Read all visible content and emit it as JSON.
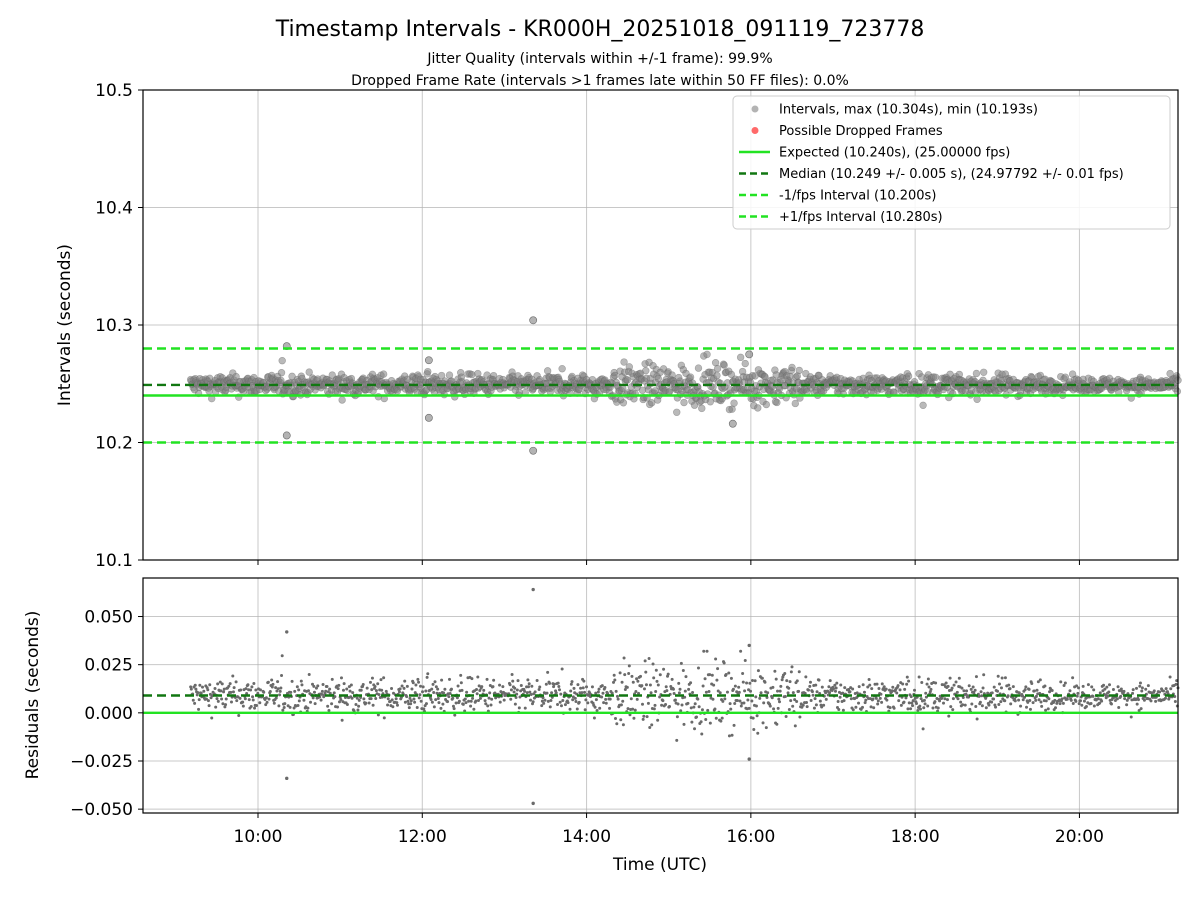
{
  "chart_data": [
    {
      "type": "scatter",
      "title": "Timestamp Intervals - KR000H_20251018_091119_723778",
      "subtitle_lines": [
        "Jitter Quality (intervals within +/-1 frame): 99.9%",
        "Dropped Frame Rate (intervals >1 frames late within 50 FF files): 0.0%"
      ],
      "ylabel": "Intervals (seconds)",
      "xlabel": "",
      "xlim_hours": [
        8.6,
        21.2
      ],
      "ylim": [
        10.1,
        10.5
      ],
      "yticks": [
        10.1,
        10.2,
        10.3,
        10.4,
        10.5
      ],
      "ytick_labels": [
        "10.1",
        "10.2",
        "10.3",
        "10.4",
        "10.5"
      ],
      "grid": true,
      "legend_position": "top-right",
      "legend": [
        {
          "label": "Intervals, max (10.304s), min (10.193s)",
          "marker": "circle",
          "color": "#808080"
        },
        {
          "label": "Possible Dropped Frames",
          "marker": "circle",
          "color": "#ff4444"
        },
        {
          "label": "Expected (10.240s), (25.00000 fps)",
          "marker": "solid",
          "color": "#22e322"
        },
        {
          "label": "Median (10.249 +/- 0.005 s), (24.97792 +/- 0.01 fps)",
          "marker": "dashed",
          "color": "#117711"
        },
        {
          "label": "-1/fps Interval (10.200s)",
          "marker": "dashed",
          "color": "#22e322"
        },
        {
          "label": "+1/fps Interval (10.280s)",
          "marker": "dashed",
          "color": "#22e322"
        }
      ],
      "reference_lines": [
        {
          "name": "expected",
          "y": 10.24,
          "style": "solid",
          "color": "#22e322"
        },
        {
          "name": "median",
          "y": 10.249,
          "style": "dashed",
          "color": "#117711"
        },
        {
          "name": "minus-one-fps",
          "y": 10.2,
          "style": "dashed",
          "color": "#22e322"
        },
        {
          "name": "plus-one-fps",
          "y": 10.28,
          "style": "dashed",
          "color": "#22e322"
        }
      ],
      "series_stats": {
        "max": 10.304,
        "min": 10.193,
        "start_hours": 9.18,
        "end_hours": 21.2,
        "count": 4200
      },
      "outliers": [
        {
          "x": 13.35,
          "y": 10.304
        },
        {
          "x": 13.35,
          "y": 10.193
        },
        {
          "x": 10.35,
          "y": 10.282
        },
        {
          "x": 10.35,
          "y": 10.206
        },
        {
          "x": 15.98,
          "y": 10.275
        },
        {
          "x": 15.78,
          "y": 10.216
        },
        {
          "x": 12.08,
          "y": 10.221
        },
        {
          "x": 12.08,
          "y": 10.27
        }
      ]
    },
    {
      "type": "scatter",
      "ylabel": "Residuals (seconds)",
      "xlabel": "Time (UTC)",
      "xlim_hours": [
        8.6,
        21.2
      ],
      "ylim": [
        -0.052,
        0.07
      ],
      "yticks": [
        -0.05,
        -0.025,
        0.0,
        0.025,
        0.05
      ],
      "ytick_labels": [
        "−0.050",
        "−0.025",
        "0.000",
        "0.025",
        "0.050"
      ],
      "xticks_hours": [
        10,
        12,
        14,
        16,
        18,
        20
      ],
      "xtick_labels": [
        "10:00",
        "12:00",
        "14:00",
        "16:00",
        "18:00",
        "20:00"
      ],
      "grid": true,
      "reference_lines": [
        {
          "name": "zero",
          "y": 0.0,
          "style": "solid",
          "color": "#22e322"
        },
        {
          "name": "median-residual",
          "y": 0.009,
          "style": "dashed",
          "color": "#117711"
        }
      ],
      "outliers": [
        {
          "x": 13.35,
          "y": 0.064
        },
        {
          "x": 13.35,
          "y": -0.047
        },
        {
          "x": 10.35,
          "y": 0.042
        },
        {
          "x": 10.35,
          "y": -0.034
        },
        {
          "x": 15.98,
          "y": 0.035
        },
        {
          "x": 15.98,
          "y": -0.024
        }
      ]
    }
  ]
}
